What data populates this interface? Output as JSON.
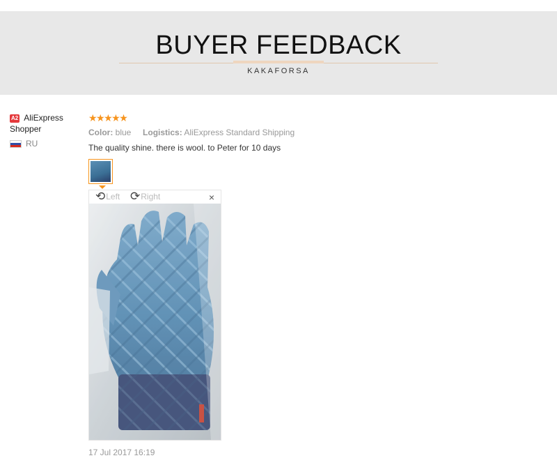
{
  "banner": {
    "title": "BUYER FEEDBACK",
    "subtitle": "KAKAFORSA"
  },
  "user": {
    "level_badge": "A2",
    "name": "AliExpress Shopper",
    "country": "RU",
    "flag_colors": [
      "#ffffff",
      "#2f4fa8",
      "#d52b1e"
    ]
  },
  "review": {
    "rating": 5,
    "stars": "★★★★★",
    "color_label": "Color:",
    "color_value": "blue",
    "logistics_label": "Logistics:",
    "logistics_value": "AliExpress Standard Shipping",
    "text": "The quality shine. there is wool. to Peter for 10 days",
    "date": "17 Jul 2017 16:19"
  },
  "viewer": {
    "rotate_left_label": "Left",
    "rotate_right_label": "Right",
    "close_label": "×",
    "icons": [
      "rotate-left-icon",
      "rotate-right-icon",
      "close-icon"
    ]
  },
  "colors": {
    "accent": "#f7941d",
    "badge": "#e4393c",
    "banner_bg": "#e8e8e8"
  }
}
